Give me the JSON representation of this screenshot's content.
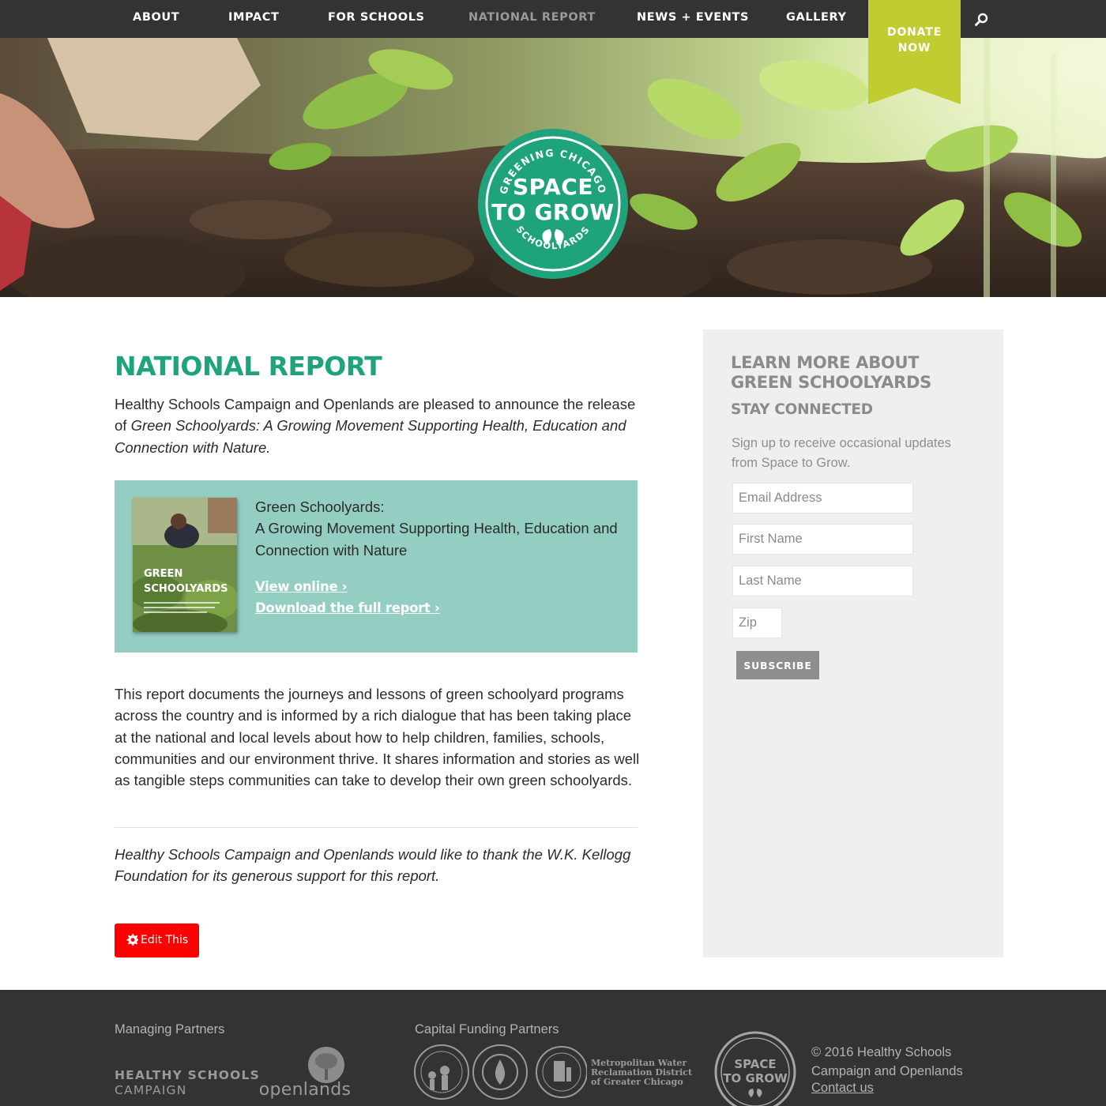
{
  "nav": {
    "items": [
      {
        "label": "ABOUT",
        "active": false
      },
      {
        "label": "IMPACT",
        "active": false
      },
      {
        "label": "FOR SCHOOLS",
        "active": false
      },
      {
        "label": "NATIONAL REPORT",
        "active": true
      },
      {
        "label": "NEWS + EVENTS",
        "active": false
      },
      {
        "label": "GALLERY",
        "active": false
      }
    ],
    "donate_label": "DONATE\nNOW",
    "search_icon": "search-icon"
  },
  "hero": {
    "logo": {
      "top_text": "GREENING CHICAGO",
      "title": "SPACE\nTO GROW",
      "bottom_text": "SCHOOLYARDS"
    }
  },
  "main": {
    "title": "NATIONAL REPORT",
    "intro_plain": "Healthy Schools Campaign and Openlands are pleased to announce the release of ",
    "intro_italic": "Green Schoolyards: A Growing Movement Supporting Health, Education and Connection with Nature.",
    "report": {
      "title_line1": "Green Schoolyards:",
      "title_line2": "A Growing Movement Supporting Health, Education and Connection with Nature",
      "view_online": "View online ›",
      "download": "Download the full report ›",
      "cover_title": "GREEN\nSCHOOLYARDS"
    },
    "body": "This report documents the journeys and lessons of green schoolyard programs across the country and is informed by a rich dialogue that has been taking place at the national and local levels about how to help children, families, schools, communities and our environment thrive. It shares information and stories as well as tangible steps communities can take to develop their own green schoolyards.",
    "thanks": "Healthy Schools Campaign and Openlands would like to thank the W.K. Kellogg Foundation for its generous support for this report.",
    "edit_button": "Edit This"
  },
  "sidebar": {
    "heading": "LEARN MORE ABOUT\nGREEN SCHOOLYARDS",
    "subheading": "STAY CONNECTED",
    "text": "Sign up to receive occasional updates from Space to Grow.",
    "fields": {
      "email_placeholder": "Email Address",
      "first_placeholder": "First Name",
      "last_placeholder": "Last Name",
      "zip_placeholder": "Zip"
    },
    "subscribe": "SUBSCRIBE"
  },
  "footer": {
    "managing_label": "Managing Partners",
    "funding_label": "Capital Funding Partners",
    "hsc_line1": "HEALTHY SCHOOLS",
    "hsc_line2": "CAMPAIGN",
    "openlands": "openlands",
    "mwrd": "Metropolitan Water\nReclamation District\nof Greater Chicago",
    "logo_title": "SPACE\nTO GROW",
    "copyright": "© 2016 Healthy Schools\nCampaign and Openlands",
    "contact": "Contact us"
  },
  "colors": {
    "nav_bg": "#333333",
    "accent_green": "#1fa37c",
    "donate_lime": "#c0cc2f",
    "report_box": "#94cdc1",
    "edit_red": "#ff0000",
    "sidebar_bg": "#efefef"
  }
}
